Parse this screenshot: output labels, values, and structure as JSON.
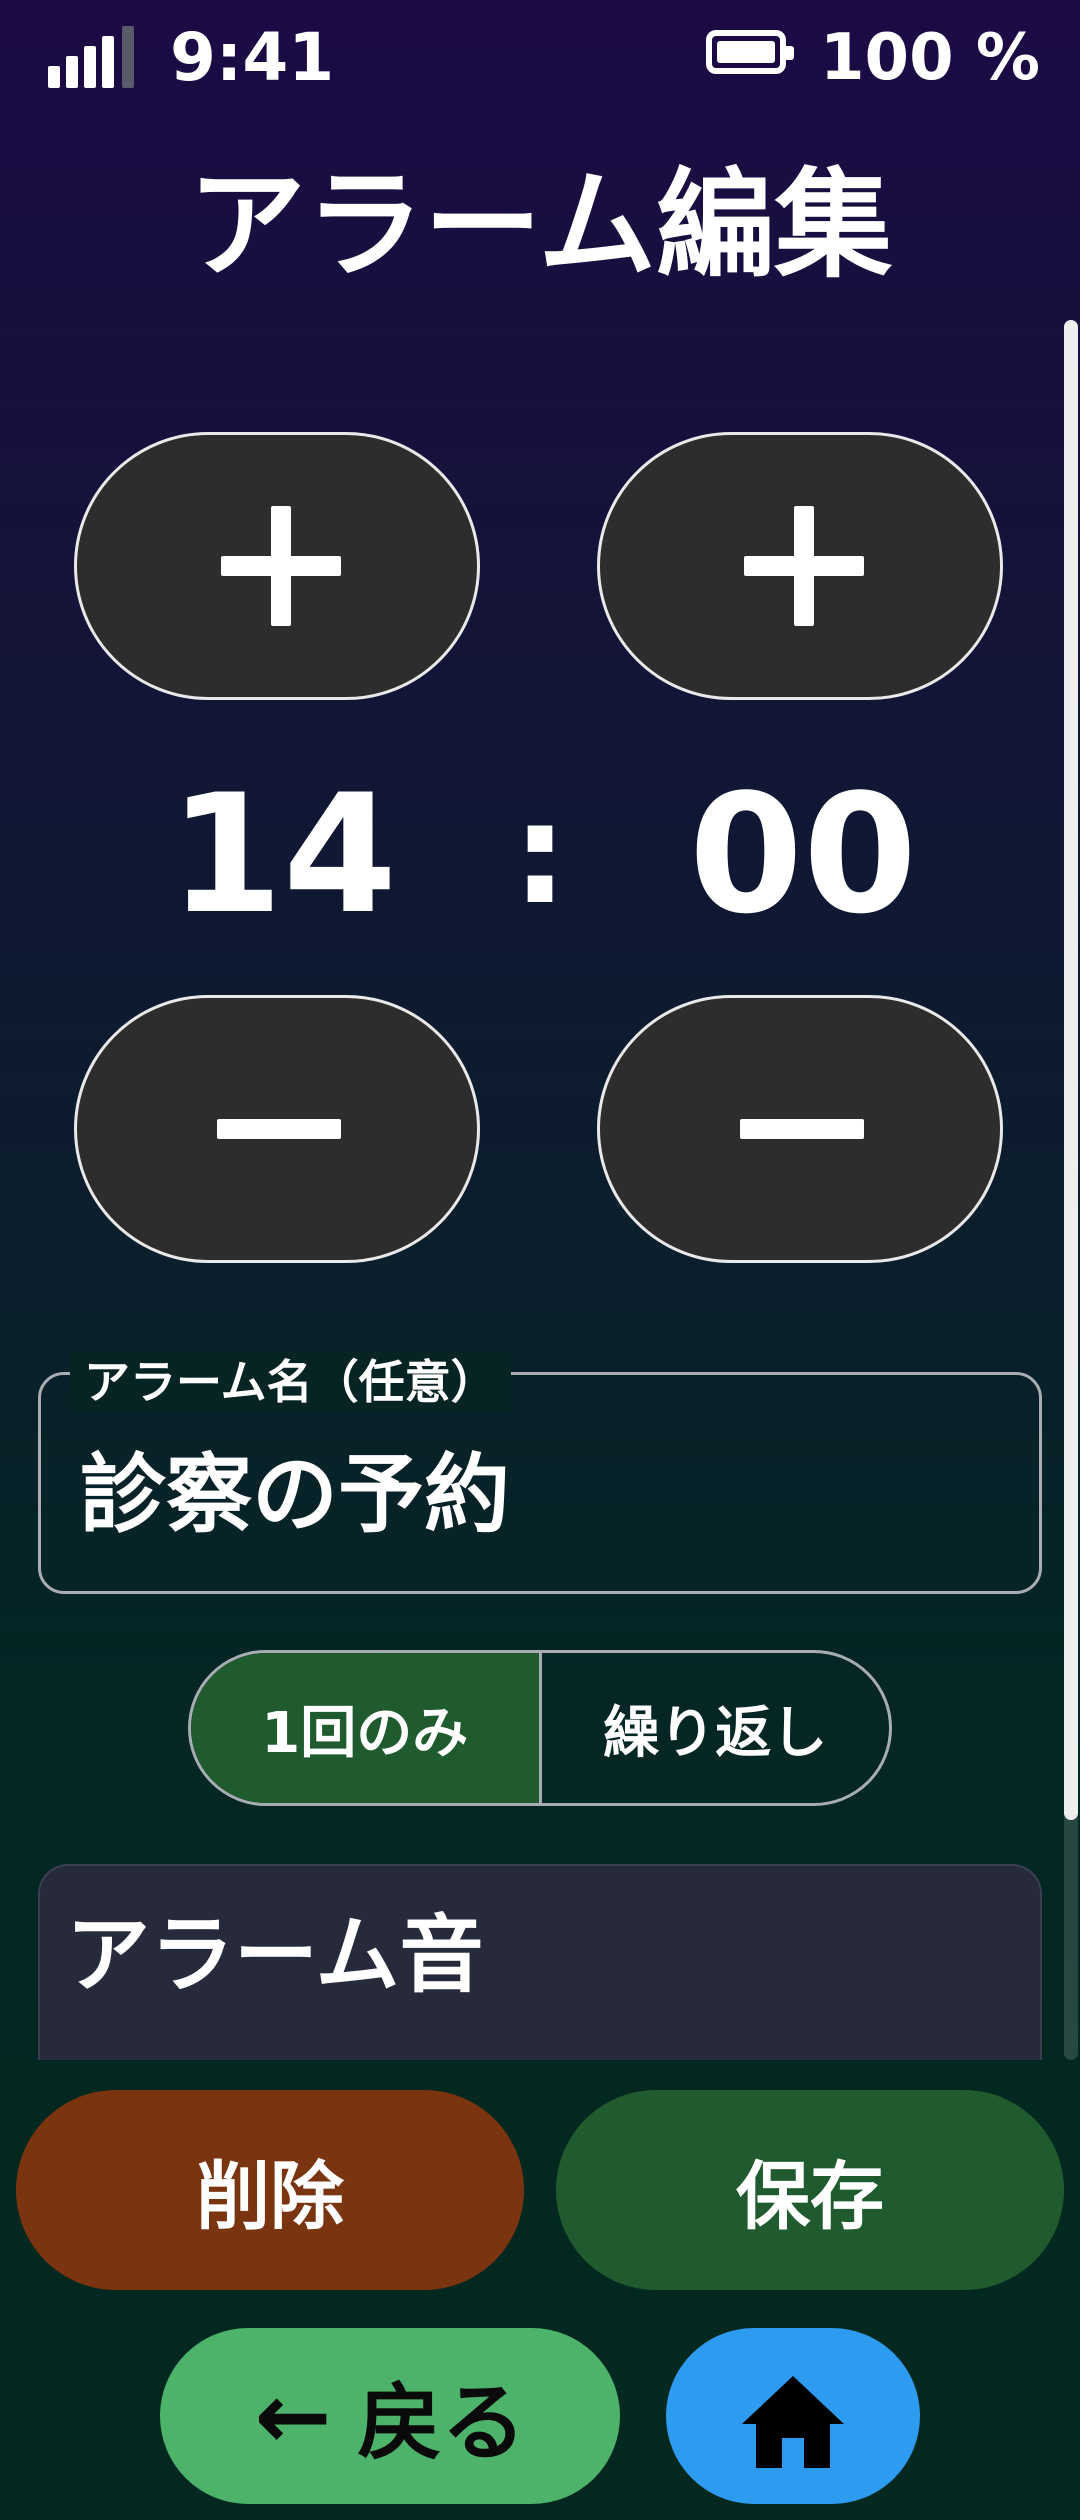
{
  "status_bar": {
    "time": "9:41",
    "battery_text": "100 %",
    "signal_icon": "signal-bars-icon",
    "battery_icon": "battery-full-icon"
  },
  "title": "アラーム編集",
  "time_picker": {
    "hour": "14",
    "minute": "00",
    "separator": ":"
  },
  "alarm_name": {
    "label": "アラーム名（任意）",
    "value": "診察の予約"
  },
  "repeat_toggle": {
    "options": [
      "1回のみ",
      "繰り返し"
    ],
    "selected": "1回のみ"
  },
  "sound_section": {
    "title": "アラーム音"
  },
  "actions": {
    "delete_label": "削除",
    "save_label": "保存",
    "back_label": "戻る",
    "back_arrow": "←"
  },
  "colors": {
    "delete": "#7a3410",
    "save": "#1f5b2e",
    "back": "#4db36a",
    "home": "#2c9bf0",
    "selected_segment": "#1f5b2e"
  }
}
